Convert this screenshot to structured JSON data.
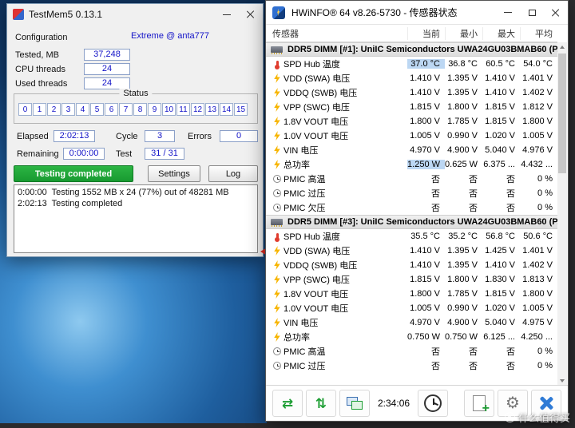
{
  "testmem5": {
    "title": "TestMem5  0.13.1",
    "labels": {
      "configuration": "Configuration",
      "tested": "Tested, MB",
      "cpu_threads": "CPU threads",
      "used_threads": "Used threads",
      "status": "Status",
      "elapsed": "Elapsed",
      "cycle": "Cycle",
      "errors": "Errors",
      "remaining": "Remaining",
      "test": "Test"
    },
    "values": {
      "configuration": "Extreme @ anta777",
      "tested": "37,248",
      "cpu_threads": "24",
      "used_threads": "24",
      "elapsed": "2:02:13",
      "cycle": "3",
      "errors": "0",
      "remaining": "0:00:00",
      "test": "31 / 31"
    },
    "threads": [
      "0",
      "1",
      "2",
      "3",
      "4",
      "5",
      "6",
      "7",
      "8",
      "9",
      "10",
      "11",
      "12",
      "13",
      "14",
      "15"
    ],
    "buttons": {
      "progress": "Testing completed",
      "settings": "Settings",
      "log": "Log"
    },
    "log_lines": [
      "0:00:00  Testing 1552 MB x 24 (77%) out of 48281 MB",
      "2:02:13  Testing completed"
    ]
  },
  "hwinfo": {
    "title": "HWiNFO® 64 v8.26-5730 - 传感器状态",
    "columns": {
      "sensor": "传感器",
      "current": "当前",
      "min": "最小",
      "max": "最大",
      "avg": "平均"
    },
    "highlight_color": "#bcd7f3",
    "groups": [
      {
        "header": "DDR5 DIMM [#1]: UniIC Semiconductors UWA24GU03BMAB60 (P...",
        "rows": [
          {
            "icon": "temp",
            "label": "SPD Hub 温度",
            "cur": "37.0 °C",
            "min": "36.8 °C",
            "max": "60.5 °C",
            "avg": "54.0 °C",
            "hl": true
          },
          {
            "icon": "volt",
            "label": "VDD (SWA) 电压",
            "cur": "1.410 V",
            "min": "1.395 V",
            "max": "1.410 V",
            "avg": "1.401 V"
          },
          {
            "icon": "volt",
            "label": "VDDQ (SWB) 电压",
            "cur": "1.410 V",
            "min": "1.395 V",
            "max": "1.410 V",
            "avg": "1.402 V"
          },
          {
            "icon": "volt",
            "label": "VPP (SWC) 电压",
            "cur": "1.815 V",
            "min": "1.800 V",
            "max": "1.815 V",
            "avg": "1.812 V"
          },
          {
            "icon": "volt",
            "label": "1.8V VOUT 电压",
            "cur": "1.800 V",
            "min": "1.785 V",
            "max": "1.815 V",
            "avg": "1.800 V"
          },
          {
            "icon": "volt",
            "label": "1.0V VOUT 电压",
            "cur": "1.005 V",
            "min": "0.990 V",
            "max": "1.020 V",
            "avg": "1.005 V"
          },
          {
            "icon": "volt",
            "label": "VIN 电压",
            "cur": "4.970 V",
            "min": "4.900 V",
            "max": "5.040 V",
            "avg": "4.976 V"
          },
          {
            "icon": "volt",
            "label": "总功率",
            "cur": "1.250 W",
            "min": "0.625 W",
            "max": "6.375 ...",
            "avg": "4.432 ...",
            "hl": true
          },
          {
            "icon": "clock",
            "label": "PMIC 高温",
            "cur": "否",
            "min": "否",
            "max": "否",
            "avg": "0 %"
          },
          {
            "icon": "clock",
            "label": "PMIC 过压",
            "cur": "否",
            "min": "否",
            "max": "否",
            "avg": "0 %"
          },
          {
            "icon": "clock",
            "label": "PMIC 欠压",
            "cur": "否",
            "min": "否",
            "max": "否",
            "avg": "0 %"
          }
        ]
      },
      {
        "header": "DDR5 DIMM [#3]: UniIC Semiconductors UWA24GU03BMAB60 (P...",
        "rows": [
          {
            "icon": "temp",
            "label": "SPD Hub 温度",
            "cur": "35.5 °C",
            "min": "35.2 °C",
            "max": "56.8 °C",
            "avg": "50.6 °C"
          },
          {
            "icon": "volt",
            "label": "VDD (SWA) 电压",
            "cur": "1.410 V",
            "min": "1.395 V",
            "max": "1.425 V",
            "avg": "1.401 V"
          },
          {
            "icon": "volt",
            "label": "VDDQ (SWB) 电压",
            "cur": "1.410 V",
            "min": "1.395 V",
            "max": "1.410 V",
            "avg": "1.402 V"
          },
          {
            "icon": "volt",
            "label": "VPP (SWC) 电压",
            "cur": "1.815 V",
            "min": "1.800 V",
            "max": "1.830 V",
            "avg": "1.813 V"
          },
          {
            "icon": "volt",
            "label": "1.8V VOUT 电压",
            "cur": "1.800 V",
            "min": "1.785 V",
            "max": "1.815 V",
            "avg": "1.800 V"
          },
          {
            "icon": "volt",
            "label": "1.0V VOUT 电压",
            "cur": "1.005 V",
            "min": "0.990 V",
            "max": "1.020 V",
            "avg": "1.005 V"
          },
          {
            "icon": "volt",
            "label": "VIN 电压",
            "cur": "4.970 V",
            "min": "4.900 V",
            "max": "5.040 V",
            "avg": "4.975 V"
          },
          {
            "icon": "volt",
            "label": "总功率",
            "cur": "0.750 W",
            "min": "0.750 W",
            "max": "6.125 ...",
            "avg": "4.250 ..."
          },
          {
            "icon": "clock",
            "label": "PMIC 高温",
            "cur": "否",
            "min": "否",
            "max": "否",
            "avg": "0 %"
          },
          {
            "icon": "clock",
            "label": "PMIC 过压",
            "cur": "否",
            "min": "否",
            "max": "否",
            "avg": "0 %"
          }
        ]
      }
    ],
    "toolbar": {
      "time": "2:34:06"
    }
  },
  "glyphs": {
    "swap_arrows": "⇄",
    "updown_arrows": "⇅",
    "gear": "⚙"
  },
  "watermark": "什么值得买"
}
